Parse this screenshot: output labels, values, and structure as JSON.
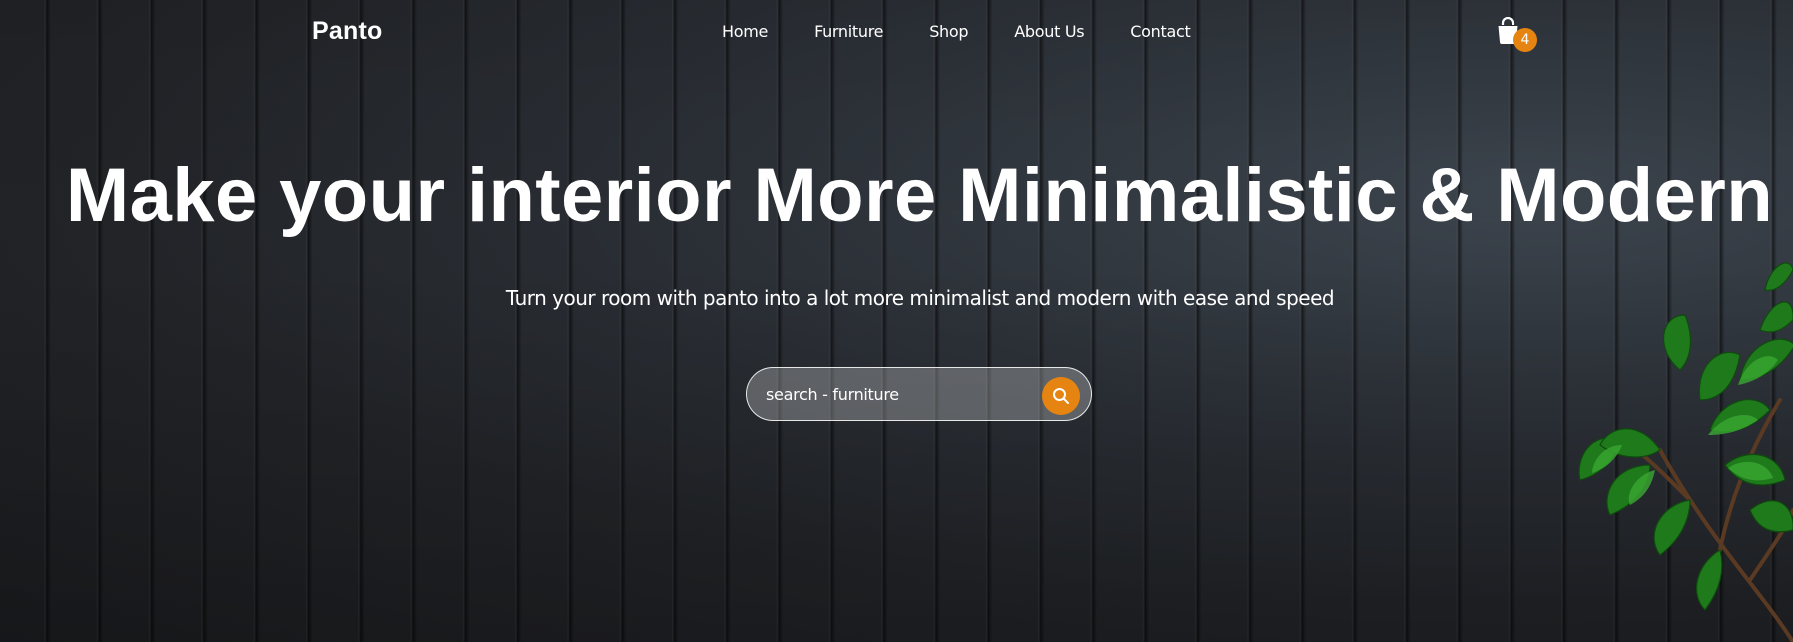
{
  "nav": {
    "logo": "Panto",
    "links": [
      {
        "label": "Home"
      },
      {
        "label": "Furniture"
      },
      {
        "label": "Shop"
      },
      {
        "label": "About Us"
      },
      {
        "label": "Contact"
      }
    ],
    "cart": {
      "icon": "shopping-bag-icon",
      "count": "4"
    }
  },
  "hero": {
    "title": "Make your interior More Minimalistic & Modern",
    "subtitle": "Turn your room with panto into a lot more minimalist and modern with ease and speed"
  },
  "search": {
    "placeholder": "search - furniture",
    "button_icon": "search-icon"
  },
  "colors": {
    "accent": "#e58411",
    "text": "#ffffff",
    "background": "#1d1f22"
  }
}
